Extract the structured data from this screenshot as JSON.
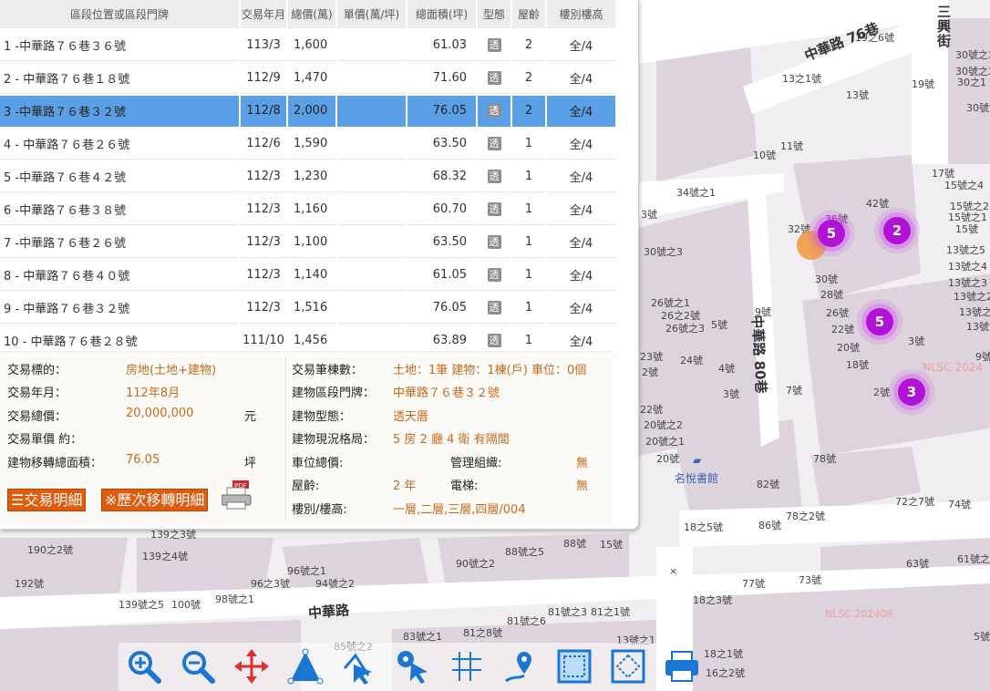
{
  "list": {
    "headers": [
      "區段位置或區段門牌",
      "交易年月",
      "總價(萬)",
      "單價(萬/坪)",
      "總面積(坪)",
      "型態",
      "屋齡",
      "樓別樓高"
    ],
    "rows": [
      {
        "addr": "1 -中華路７６巷３６號",
        "ym": "113/3",
        "total": "1,600",
        "unit": "",
        "area": "61.03",
        "type": "透",
        "age": "2",
        "floor": "全/4"
      },
      {
        "addr": "2 - 中華路７６巷１８號",
        "ym": "112/9",
        "total": "1,470",
        "unit": "",
        "area": "71.60",
        "type": "透",
        "age": "2",
        "floor": "全/4"
      },
      {
        "addr": "3 -中華路７６巷３２號",
        "ym": "112/8",
        "total": "2,000",
        "unit": "",
        "area": "76.05",
        "type": "透",
        "age": "2",
        "floor": "全/4"
      },
      {
        "addr": "4 - 中華路７６巷２６號",
        "ym": "112/6",
        "total": "1,590",
        "unit": "",
        "area": "63.50",
        "type": "透",
        "age": "1",
        "floor": "全/4"
      },
      {
        "addr": "5 -中華路７６巷４２號",
        "ym": "112/3",
        "total": "1,230",
        "unit": "",
        "area": "68.32",
        "type": "透",
        "age": "1",
        "floor": "全/4"
      },
      {
        "addr": "6 -中華路７６巷３８號",
        "ym": "112/3",
        "total": "1,160",
        "unit": "",
        "area": "60.70",
        "type": "透",
        "age": "1",
        "floor": "全/4"
      },
      {
        "addr": "7 -中華路７６巷２６號",
        "ym": "112/3",
        "total": "1,100",
        "unit": "",
        "area": "63.50",
        "type": "透",
        "age": "1",
        "floor": "全/4"
      },
      {
        "addr": "8 - 中華路７６巷４０號",
        "ym": "112/3",
        "total": "1,140",
        "unit": "",
        "area": "61.05",
        "type": "透",
        "age": "1",
        "floor": "全/4"
      },
      {
        "addr": "9 - 中華路７６巷３２號",
        "ym": "112/3",
        "total": "1,516",
        "unit": "",
        "area": "76.05",
        "type": "透",
        "age": "1",
        "floor": "全/4"
      },
      {
        "addr": "10 - 中華路７６巷２８號",
        "ym": "111/10",
        "total": "1,456",
        "unit": "",
        "area": "63.89",
        "type": "透",
        "age": "1",
        "floor": "全/4"
      }
    ],
    "selected_index": 2
  },
  "detail": {
    "target_label": "交易標的：",
    "target_value": "房地(土地+建物)",
    "ym_label": "交易年月：",
    "ym_value": "112年8月",
    "total_label": "交易總價：",
    "total_value": "20,000,000",
    "total_unit": "元",
    "unitprice_label": "交易單價 約：",
    "unitprice_value": "",
    "area_label": "建物移轉總面積：",
    "area_value": "76.05",
    "area_unit": "坪",
    "count_label": "交易筆棟數：",
    "count_value": "土地：1筆 建物：1棟(戶) 車位：0個",
    "door_label": "建物區段門牌：",
    "door_value": "中華路７６巷３２號",
    "type_label": "建物型態：",
    "type_value": "透天厝",
    "layout_label": "建物現況格局：",
    "layout_value": "5 房 2 廳 4 衛 有隔間",
    "parking_label": "車位總價:",
    "parking_value": "",
    "mgmt_label": "管理組織:",
    "mgmt_value": "無",
    "age_label": "屋齡:",
    "age_value": "2 年",
    "elevator_label": "電梯:",
    "elevator_value": "無",
    "floor_label": "樓別/樓高:",
    "floor_value": "一層,二層,三層,四層/004",
    "btn_detail": "☰交易明細",
    "btn_history": "※歷次移轉明細",
    "pdf_icon": "pdf-print-icon"
  },
  "map": {
    "roads": {
      "r76": "中華路 76巷",
      "r80": "中華路 80巷",
      "main": "中華路",
      "sanxing": "三興街"
    },
    "poi": "名悅書館",
    "watermark": "NLSC 2024",
    "watermark2": "NLSC 202408",
    "labels": [
      "19之6號",
      "13之1號",
      "13號",
      "19號",
      "30號之2",
      "30號之2",
      "30之1",
      "30號",
      "11號",
      "10號",
      "17號",
      "15號之4",
      "15號之2",
      "15號之1",
      "15號",
      "13號之5",
      "13號之4",
      "13號之3",
      "13號之2",
      "13號之1",
      "13號",
      "34號之1",
      "3號",
      "42號",
      "32號",
      "36號",
      "30號之3",
      "30號",
      "28號",
      "26號之1",
      "26之2號",
      "26號之3",
      "5號",
      "9號",
      "26號",
      "22號",
      "20號",
      "3號",
      "18號",
      "23號",
      "24號",
      "4號",
      "2號",
      "2號",
      "3號",
      "7號",
      "9號",
      "22號",
      "20號之2",
      "20號之1",
      "20號",
      "78號",
      "82號",
      "72之7號",
      "74號",
      "18之5號",
      "86號",
      "78之2號",
      "139之3號",
      "190之2號",
      "139之4號",
      "96號之1",
      "96之3號",
      "94號之2",
      "88號之5",
      "88號",
      "15號",
      "90號之2",
      "192號",
      "139號之5",
      "100號",
      "98號之1",
      "63號",
      "61號之",
      "77號",
      "73號",
      "18之3號",
      "81號之6",
      "81號之3",
      "81之1號",
      "83號之1",
      "81之8號",
      "13號之1",
      "85號之2",
      "18之1號",
      "16之2號",
      "5號"
    ],
    "clusters": [
      "5",
      "2",
      "5",
      "3"
    ]
  },
  "toolbar": [
    "zoom-in-icon",
    "zoom-out-icon",
    "pan-move-icon",
    "measure-area-icon",
    "measure-distance-icon",
    "locate-point-icon",
    "coordinate-grid-icon",
    "route-marker-icon",
    "frame-select-icon",
    "frame-dashed-icon",
    "print-icon"
  ]
}
